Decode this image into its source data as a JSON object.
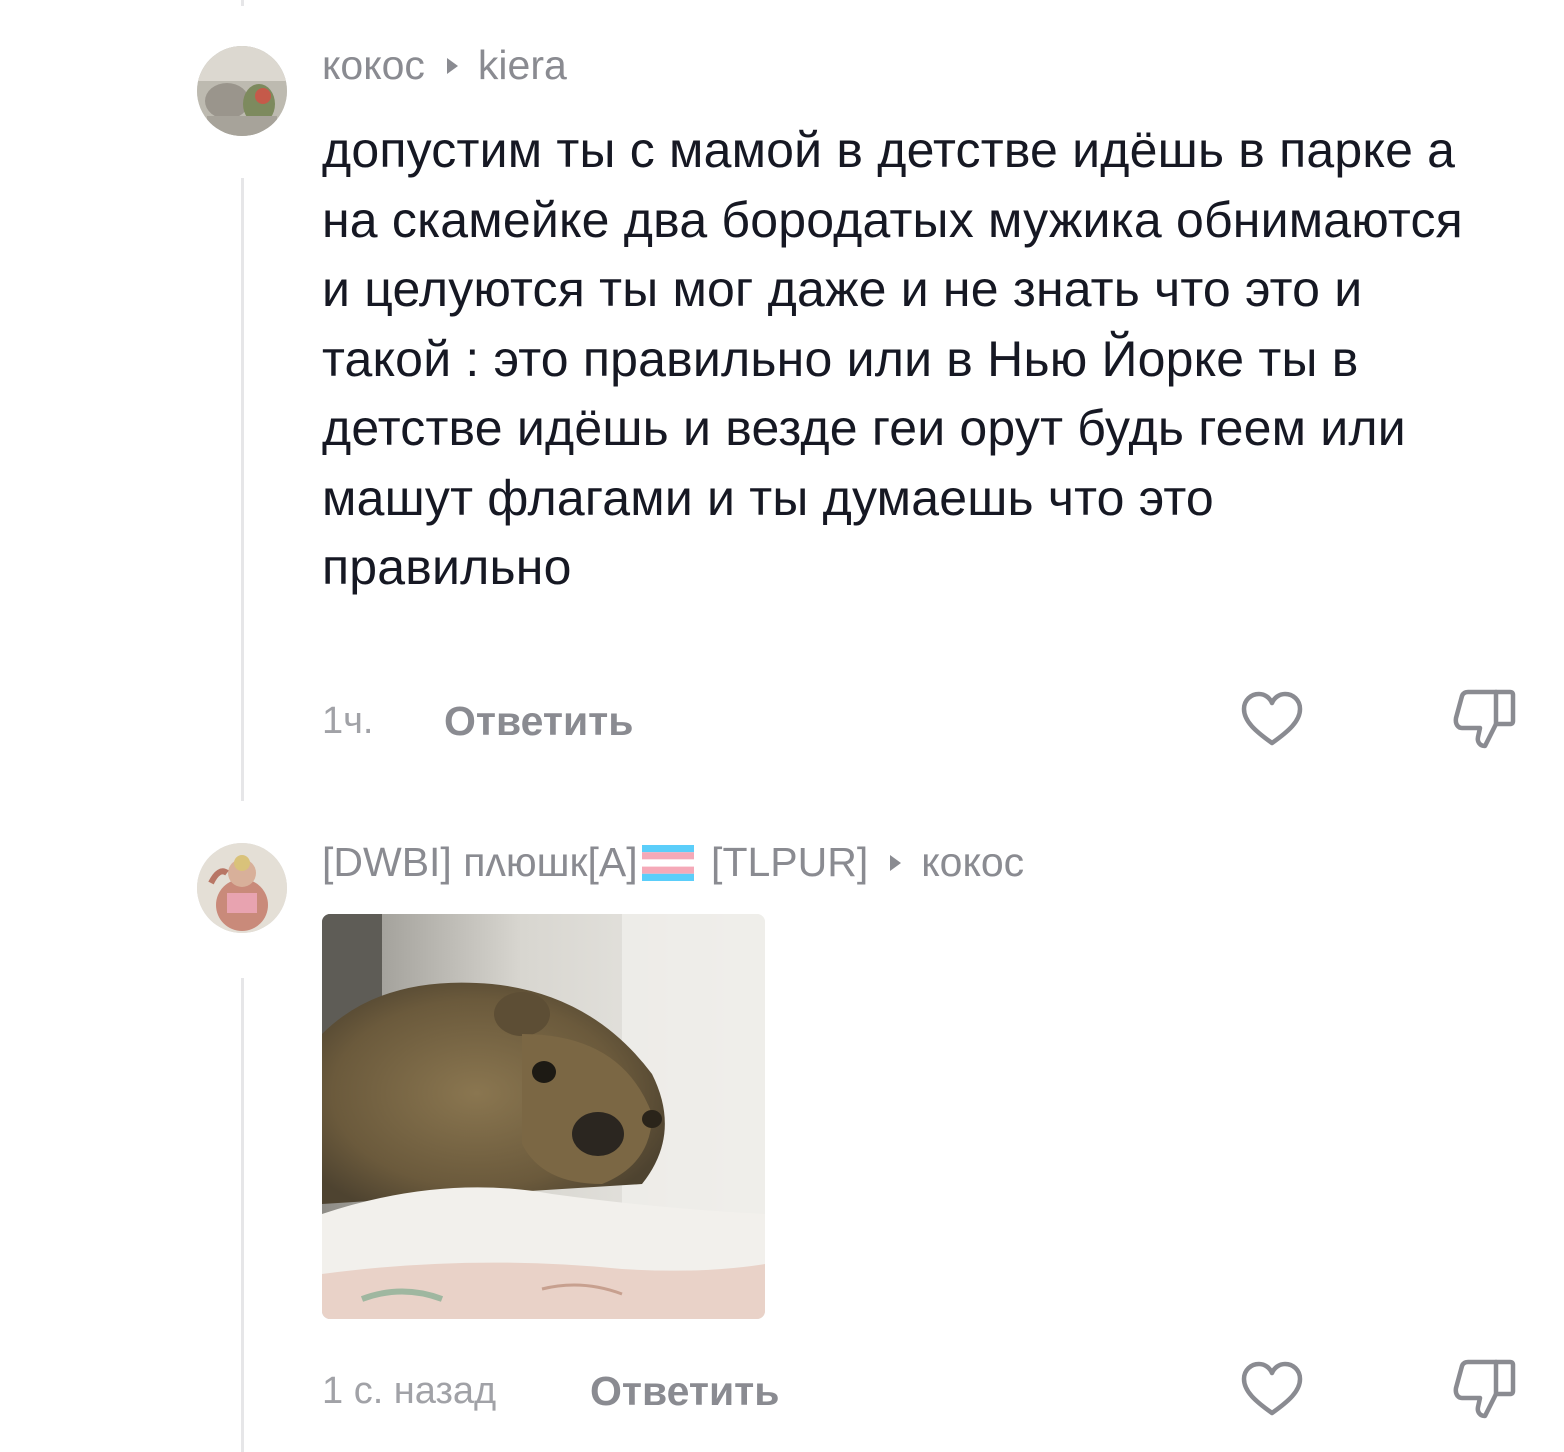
{
  "comments": [
    {
      "author": "кокос",
      "reply_to": "kiera",
      "text": "допустим ты с мамой в детстве идёшь в парке а на скамейке два бородатых мужика обнимаются и целуются ты мог даже и не знать что это и такой : это правильно или в Нью Йорке ты в детстве идёшь и везде геи орут будь геем или машут флагами и ты думаешь что это правильно",
      "time": "1ч.",
      "reply_label": "Ответить",
      "like_icon": "heart-icon",
      "dislike_icon": "thumbs-down-icon"
    },
    {
      "author_prefix": "[DWBI] пʌюшк[A]",
      "author_flag_icon": "transgender-flag-icon",
      "author_suffix": "[TLPUR]",
      "reply_to": "кокос",
      "attachment": "hyrax-photo",
      "time": "1 с. назад",
      "reply_label": "Ответить",
      "like_icon": "heart-icon",
      "dislike_icon": "thumbs-down-icon"
    }
  ],
  "colors": {
    "text": "#161823",
    "meta": "#8a8b91",
    "timestamp": "#a1a2a7",
    "thread_line": "#e6e6e8",
    "flag_blue": "#5bcefa",
    "flag_pink": "#f5a9b8",
    "flag_white": "#ffffff"
  }
}
